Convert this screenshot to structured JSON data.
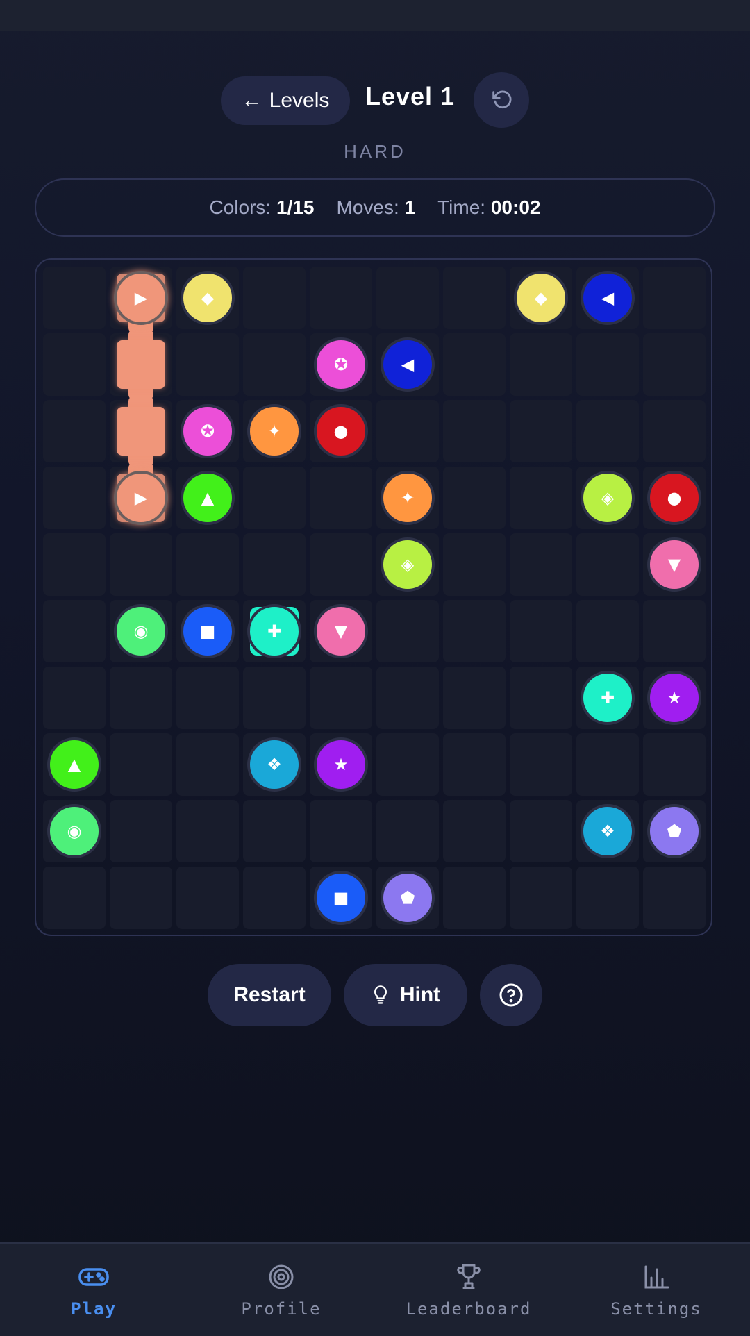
{
  "header": {
    "back_arrow": "←",
    "back_label": "Levels",
    "level_title": "Level 1",
    "reset_icon": "undo-icon",
    "difficulty": "HARD"
  },
  "stats": {
    "colors_label": "Colors:",
    "colors_value": "1/15",
    "moves_label": "Moves:",
    "moves_value": "1",
    "time_label": "Time:",
    "time_value": "00:02"
  },
  "board": {
    "rows": 10,
    "cols": 10,
    "dots": [
      {
        "row": 0,
        "col": 1,
        "color": "#f0967a",
        "symbol": "▶",
        "active": true
      },
      {
        "row": 0,
        "col": 2,
        "color": "#f0e36e",
        "symbol": "◆"
      },
      {
        "row": 0,
        "col": 7,
        "color": "#f0e36e",
        "symbol": "◆"
      },
      {
        "row": 0,
        "col": 8,
        "color": "#1022d8",
        "symbol": "◀"
      },
      {
        "row": 1,
        "col": 4,
        "color": "#ec4fd8",
        "symbol": "✪"
      },
      {
        "row": 1,
        "col": 5,
        "color": "#1022d8",
        "symbol": "◀"
      },
      {
        "row": 2,
        "col": 2,
        "color": "#ec4fd8",
        "symbol": "✪"
      },
      {
        "row": 2,
        "col": 3,
        "color": "#ff9640",
        "symbol": "✦"
      },
      {
        "row": 2,
        "col": 4,
        "color": "#d81620",
        "symbol": "●"
      },
      {
        "row": 3,
        "col": 1,
        "color": "#f0967a",
        "symbol": "▶",
        "active": true
      },
      {
        "row": 3,
        "col": 2,
        "color": "#42f01a",
        "symbol": "▲"
      },
      {
        "row": 3,
        "col": 5,
        "color": "#ff9640",
        "symbol": "✦"
      },
      {
        "row": 3,
        "col": 8,
        "color": "#b8f043",
        "symbol": "◈"
      },
      {
        "row": 3,
        "col": 9,
        "color": "#d81620",
        "symbol": "●"
      },
      {
        "row": 4,
        "col": 5,
        "color": "#b8f043",
        "symbol": "◈"
      },
      {
        "row": 4,
        "col": 9,
        "color": "#f06eac",
        "symbol": "▼"
      },
      {
        "row": 5,
        "col": 1,
        "color": "#4ef07a",
        "symbol": "◉"
      },
      {
        "row": 5,
        "col": 2,
        "color": "#1a5cf8",
        "symbol": "■"
      },
      {
        "row": 5,
        "col": 3,
        "color": "#1ef0c8",
        "symbol": "✚",
        "tile": true
      },
      {
        "row": 5,
        "col": 4,
        "color": "#f06eac",
        "symbol": "▼"
      },
      {
        "row": 6,
        "col": 8,
        "color": "#1ef0c8",
        "symbol": "✚"
      },
      {
        "row": 6,
        "col": 9,
        "color": "#a01ef0",
        "symbol": "★"
      },
      {
        "row": 7,
        "col": 0,
        "color": "#42f01a",
        "symbol": "▲"
      },
      {
        "row": 7,
        "col": 3,
        "color": "#1aa8d8",
        "symbol": "❖"
      },
      {
        "row": 7,
        "col": 4,
        "color": "#a01ef0",
        "symbol": "★"
      },
      {
        "row": 8,
        "col": 0,
        "color": "#4ef07a",
        "symbol": "◉"
      },
      {
        "row": 8,
        "col": 8,
        "color": "#1aa8d8",
        "symbol": "❖"
      },
      {
        "row": 8,
        "col": 9,
        "color": "#8c78f0",
        "symbol": "⬟"
      },
      {
        "row": 9,
        "col": 4,
        "color": "#1a5cf8",
        "symbol": "■"
      },
      {
        "row": 9,
        "col": 5,
        "color": "#8c78f0",
        "symbol": "⬟"
      }
    ],
    "paths": [
      {
        "color": "#f0967a",
        "cells": [
          [
            0,
            1
          ],
          [
            1,
            1
          ],
          [
            2,
            1
          ],
          [
            3,
            1
          ]
        ]
      }
    ]
  },
  "controls": {
    "restart_label": "Restart",
    "hint_label": "Hint",
    "hint_icon": "lightbulb-icon",
    "help_icon": "help-circle-icon"
  },
  "tabs": [
    {
      "label": "Play",
      "icon": "gamepad-icon",
      "active": true
    },
    {
      "label": "Profile",
      "icon": "target-icon",
      "active": false
    },
    {
      "label": "Leaderboard",
      "icon": "trophy-icon",
      "active": false
    },
    {
      "label": "Settings",
      "icon": "bar-chart-icon",
      "active": false
    }
  ],
  "colors": {
    "accent": "#4a8ff0",
    "background": "#12162a",
    "button": "#232846"
  }
}
